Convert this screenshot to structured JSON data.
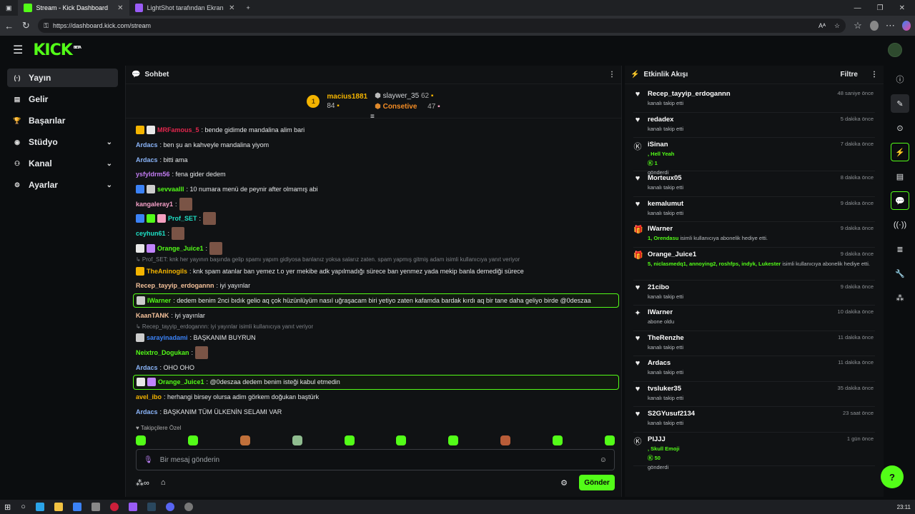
{
  "browser": {
    "tabs": [
      {
        "title": "Stream - Kick Dashboard",
        "color": "#53fc18"
      },
      {
        "title": "LightShot tarafından Ekran Görün",
        "color": "#9a5cf6"
      }
    ],
    "url": "https://dashboard.kick.com/stream"
  },
  "app": {
    "logo": "KICK",
    "logo_badge": "BETA"
  },
  "sidebar": {
    "items": [
      {
        "label": "Yayın",
        "icon": "broadcast-icon",
        "glyph": "(·)"
      },
      {
        "label": "Gelir",
        "icon": "revenue-icon",
        "glyph": "▤"
      },
      {
        "label": "Başarılar",
        "icon": "trophy-icon",
        "glyph": "🏆"
      },
      {
        "label": "Stüdyo",
        "icon": "studio-icon",
        "glyph": "◉"
      },
      {
        "label": "Kanal",
        "icon": "channel-icon",
        "glyph": "⚇"
      },
      {
        "label": "Ayarlar",
        "icon": "gear-icon",
        "glyph": "⚙"
      }
    ]
  },
  "chat": {
    "title": "Sohbet",
    "leaderboard": {
      "first": {
        "rank": "1",
        "name": "macius1881",
        "count": "84"
      },
      "second": {
        "name": "slaywer_35",
        "count": "62"
      },
      "third": {
        "name": "Consetive",
        "count": "47"
      }
    },
    "messages": [
      {
        "user": "MRFamous_5",
        "ucolor": "#e2264d",
        "text": ": bende gidimde mandalina alim bari",
        "badges": [
          "#f4b400",
          "#e8e8e8"
        ],
        "emote": false,
        "hl": false
      },
      {
        "user": "Ardacs",
        "ucolor": "#8ab4f8",
        "text": ": ben şu an kahveyle mandalina yiyom",
        "badges": [],
        "emote": false,
        "hl": false
      },
      {
        "user": "Ardacs",
        "ucolor": "#8ab4f8",
        "text": ": bitti ama",
        "badges": [],
        "emote": false,
        "hl": false
      },
      {
        "user": "ysfyldrm56",
        "ucolor": "#c27cf2",
        "text": ": fena gider dedem",
        "badges": [],
        "emote": false,
        "hl": false
      },
      {
        "user": "sevvaalll",
        "ucolor": "#53fc18",
        "text": ": 10 numara menü de peynir after olmamış abi",
        "badges": [
          "#3b82f6",
          "#cccccc"
        ],
        "emote": false,
        "hl": false
      },
      {
        "user": "kangaleray1",
        "ucolor": "#f5a0c8",
        "text": ":",
        "badges": [],
        "emote": true,
        "hl": false
      },
      {
        "user": "Prof_SET",
        "ucolor": "#1ee0c5",
        "text": ":",
        "badges": [
          "#3b82f6",
          "#53fc18",
          "#f4a0c0"
        ],
        "emote": true,
        "hl": false
      },
      {
        "user": "ceyhun61",
        "ucolor": "#1ee0c5",
        "text": ":",
        "badges": [],
        "emote": true,
        "hl": false
      },
      {
        "user": "Orange_Juice1",
        "ucolor": "#53fc18",
        "text": ":",
        "badges": [
          "#e8e8e8",
          "#c084fc"
        ],
        "emote": true,
        "hl": false
      },
      {
        "user": "TheAninogils",
        "ucolor": "#f4b400",
        "text": ": knk spam atanlar ban yemez t.o yer mekibe adk yapılmadığı sürece ban yenmez yada mekip banla demediği sürece",
        "badges": [
          "#f4b400"
        ],
        "emote": false,
        "hl": false,
        "reply": "↳ Prof_SET: knk her yayının başında gelip  spamı yapım gidiyosa banlanız yoksa salarız zaten. spam yapmış gitmiş adam isimli kullanıcıya yanıt veriyor"
      },
      {
        "user": "Recep_tayyip_erdogannn",
        "ucolor": "#f5c29b",
        "text": ": iyi yayınlar",
        "badges": [],
        "emote": false,
        "hl": false
      },
      {
        "user": "IWarner",
        "ucolor": "#53fc18",
        "text": ": dedem benim 2nci bıdık gelio aq çok hüzünlüyüm nasıl uğraşacam biri yetiyo zaten kafamda bardak kırdı aq bir tane daha geliyo birde @0deszaa",
        "badges": [
          "#cccccc"
        ],
        "emote": false,
        "hl": true
      },
      {
        "user": "KaanTANK",
        "ucolor": "#f5c29b",
        "text": ": iyi yayınlar",
        "badges": [],
        "emote": false,
        "hl": false
      },
      {
        "user": "sarayinadami",
        "ucolor": "#3b82f6",
        "text": ": BAŞKANIM BUYRUN",
        "badges": [
          "#cccccc"
        ],
        "emote": false,
        "hl": false,
        "reply": "↳ Recep_tayyip_erdogannn: iyi yayınlar isimli kullanıcıya yanıt veriyor"
      },
      {
        "user": "Neixtro_Dogukan",
        "ucolor": "#53fc18",
        "text": ":",
        "badges": [],
        "emote": true,
        "hl": false
      },
      {
        "user": "Ardacs",
        "ucolor": "#8ab4f8",
        "text": ": OHO OHO",
        "badges": [],
        "emote": false,
        "hl": false
      },
      {
        "user": "Orange_Juice1",
        "ucolor": "#53fc18",
        "text": ": @0deszaa dedem benim isteği kabul etmedin",
        "badges": [
          "#e8e8e8",
          "#c084fc"
        ],
        "emote": false,
        "hl": true
      },
      {
        "user": "avel_ibo",
        "ucolor": "#f4b400",
        "text": ": herhangi birsey olursa adim görkem doğukan baştürk",
        "badges": [],
        "emote": false,
        "hl": false
      },
      {
        "user": "Ardacs",
        "ucolor": "#8ab4f8",
        "text": ": BAŞKANIM TÜM ÜLKENİN SELAMI VAR",
        "badges": [],
        "emote": false,
        "hl": false
      }
    ],
    "follower_label": "♥ Takipçilere Özel",
    "input_placeholder": "Bir mesaj gönderin",
    "send_label": "Gönder"
  },
  "activity": {
    "title": "Etkinlik Akışı",
    "filter_label": "Filtre",
    "items": [
      {
        "icon": "heart-icon",
        "glyph": "♥",
        "name": "Recep_tayyip_erdogannn",
        "sub": "kanalı takip etti",
        "time": "48 saniye önce"
      },
      {
        "icon": "heart-icon",
        "glyph": "♥",
        "name": "redadex",
        "sub": "kanalı takip etti",
        "time": "5 dakika önce"
      },
      {
        "icon": "kick-icon",
        "glyph": "Ⓚ",
        "name": "iSinan",
        "sub": ", Hell Yeah",
        "extra": "1",
        "extra2": "gönderdi",
        "time": "7 dakika önce"
      },
      {
        "icon": "heart-icon",
        "glyph": "♥",
        "name": "Morteux05",
        "sub": "kanalı takip etti",
        "time": "8 dakika önce"
      },
      {
        "icon": "heart-icon",
        "glyph": "♥",
        "name": "kemalumut",
        "sub": "kanalı takip etti",
        "time": "9 dakika önce"
      },
      {
        "icon": "gift-icon",
        "glyph": "🎁",
        "name": "IWarner",
        "sub_green": "1, Orendasu",
        "sub": " isimli kullanıcıya abonelik hediye etti.",
        "time": "9 dakika önce"
      },
      {
        "icon": "gift-icon",
        "glyph": "🎁",
        "name": "Orange_Juice1",
        "sub_green": "5, niclasmedq1, annoying2, roshfps, indyk, Lukester",
        "sub": " isimli kullanıcıya abonelik hediye etti.",
        "time": "9 dakika önce"
      },
      {
        "icon": "heart-icon",
        "glyph": "♥",
        "name": "21cibo",
        "sub": "kanalı takip etti",
        "time": "9 dakika önce"
      },
      {
        "icon": "sparkle-icon",
        "glyph": "✦",
        "name": "IWarner",
        "sub": "abone oldu",
        "time": "10 dakika önce"
      },
      {
        "icon": "heart-icon",
        "glyph": "♥",
        "name": "TheRenzhe",
        "sub": "kanalı takip etti",
        "time": "11 dakika önce"
      },
      {
        "icon": "heart-icon",
        "glyph": "♥",
        "name": "Ardacs",
        "sub": "kanalı takip etti",
        "time": "11 dakika önce"
      },
      {
        "icon": "heart-icon",
        "glyph": "♥",
        "name": "tvsluker35",
        "sub": "kanalı takip etti",
        "time": "35 dakika önce"
      },
      {
        "icon": "heart-icon",
        "glyph": "♥",
        "name": "S2GYusuf2134",
        "sub": "kanalı takip etti",
        "time": "23 saat önce"
      },
      {
        "icon": "kick-icon",
        "glyph": "Ⓚ",
        "name": "PIJJJ",
        "sub": ", Skull Emoji",
        "extra": "50",
        "extra2": "gönderdi",
        "time": "1 gün önce"
      }
    ]
  },
  "taskbar": {
    "time": "23:11"
  }
}
